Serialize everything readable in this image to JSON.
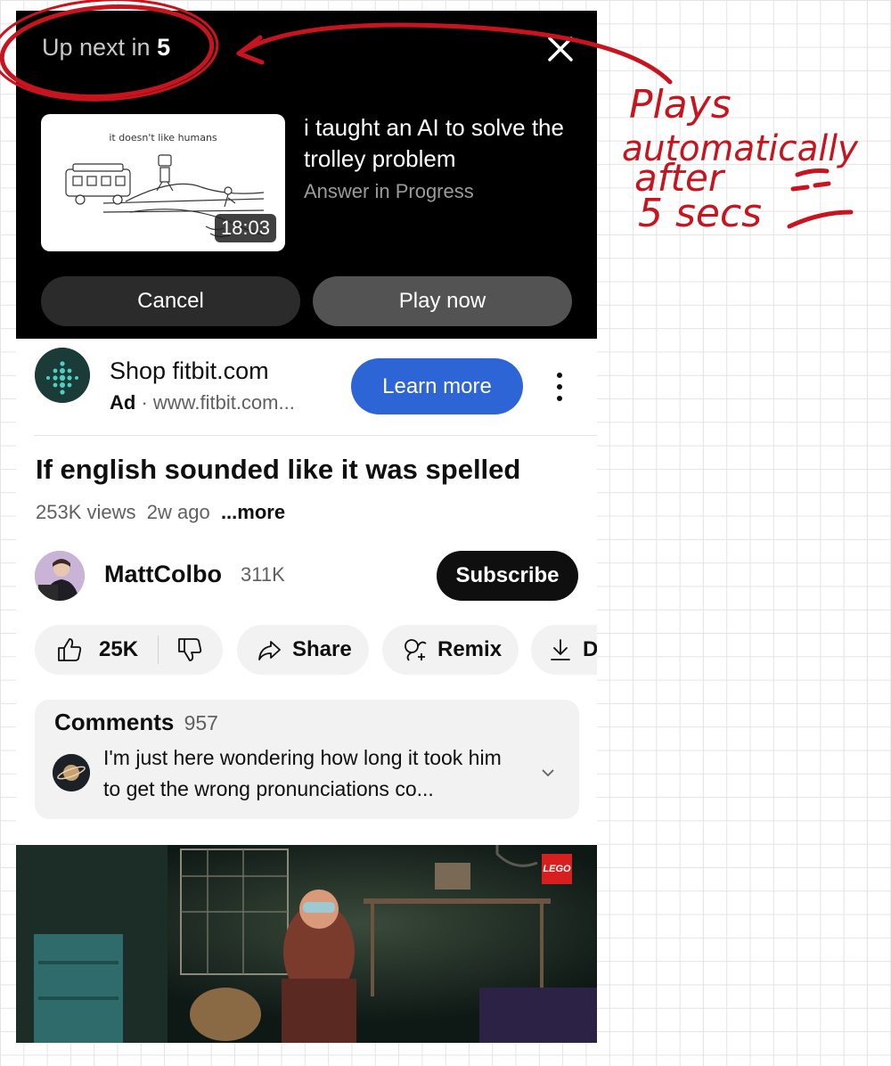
{
  "up_next": {
    "prefix": "Up next in",
    "countdown": "5",
    "video_title": "i taught an AI to solve the trolley problem",
    "channel": "Answer in Progress",
    "duration": "18:03",
    "thumbnail_caption": "it doesn't like humans",
    "cancel_label": "Cancel",
    "play_label": "Play now"
  },
  "ad": {
    "title": "Shop fitbit.com",
    "badge": "Ad",
    "separator": "·",
    "url": "www.fitbit.com...",
    "cta": "Learn more"
  },
  "video": {
    "title": "If english sounded like it was spelled",
    "views": "253K views",
    "age": "2w ago",
    "more": "...more"
  },
  "channel": {
    "name": "MattColbo",
    "subscribers": "311K",
    "subscribe_label": "Subscribe"
  },
  "actions": {
    "likes": "25K",
    "share": "Share",
    "remix": "Remix",
    "download_partial": "D"
  },
  "comments": {
    "label": "Comments",
    "count": "957",
    "top_comment": "I'm just here wondering how long it took him to get the wrong pronunciations co..."
  },
  "preview": {
    "brand_badge": "LEGO"
  },
  "annotation": {
    "line1": "Plays",
    "line2": "automatically",
    "line3": "after",
    "line4": "5 secs",
    "color": "#c8141e"
  },
  "colors": {
    "learn_more": "#2e65d6",
    "subscribe_bg": "#0f0f0f",
    "overlay_bg": "#000000",
    "annotation_red": "#c8141e"
  }
}
